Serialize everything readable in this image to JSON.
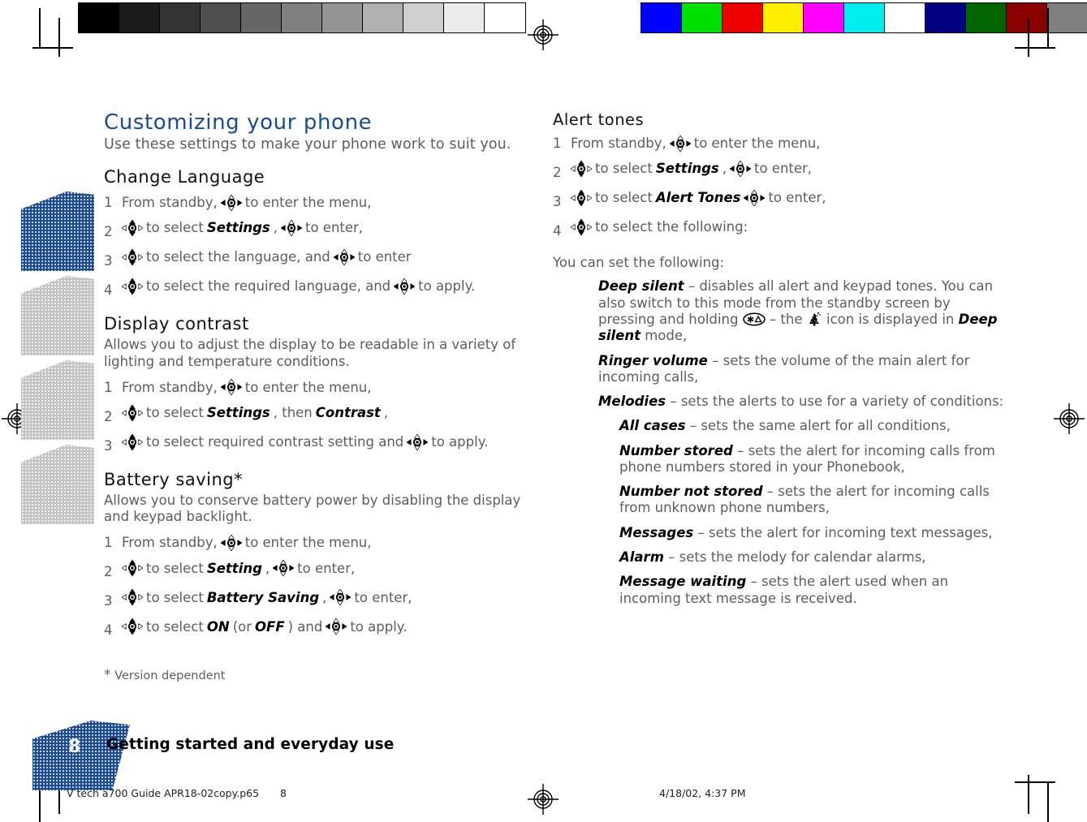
{
  "print_marks": {
    "gray_strip_label": "grayscale-calibration-strip",
    "gray_swatches": [
      "#000000",
      "#1c1c1c",
      "#333333",
      "#4d4d4d",
      "#666666",
      "#808080",
      "#939393",
      "#b0b0b0",
      "#cfcfcf",
      "#ececec",
      "#ffffff"
    ],
    "color_strip_label": "color-calibration-strip",
    "color_swatches": [
      "#0000ff",
      "#00e000",
      "#ee0000",
      "#ffee00",
      "#ff00ff",
      "#00eeee",
      "#ffffff",
      "#000080",
      "#006400",
      "#8b0000",
      "#808080"
    ]
  },
  "colors": {
    "heading_blue": "#1b4b93",
    "body_gray": "#5d5d5d",
    "tab_gray": "#c3c3c3"
  },
  "left_column": {
    "title": "Customizing your phone",
    "lead": "Use these settings to make your phone work to suit you.",
    "sections": [
      {
        "heading": "Change Language",
        "intro": "",
        "steps": [
          {
            "num": "1",
            "parts": [
              {
                "t": "text",
                "v": "From standby,"
              },
              {
                "t": "navkey",
                "v": "horizontal"
              },
              {
                "t": "text",
                "v": "to enter the menu,"
              }
            ]
          },
          {
            "num": "2",
            "parts": [
              {
                "t": "navkey",
                "v": "vertical"
              },
              {
                "t": "text",
                "v": "to select"
              },
              {
                "t": "em",
                "v": "Settings"
              },
              {
                "t": "text",
                "v": ","
              },
              {
                "t": "navkey",
                "v": "horizontal"
              },
              {
                "t": "text",
                "v": "to enter,"
              }
            ]
          },
          {
            "num": "3",
            "parts": [
              {
                "t": "navkey",
                "v": "vertical"
              },
              {
                "t": "text",
                "v": "to select the language, and"
              },
              {
                "t": "navkey",
                "v": "horizontal"
              },
              {
                "t": "text",
                "v": "to enter"
              }
            ]
          },
          {
            "num": "4",
            "parts": [
              {
                "t": "navkey",
                "v": "vertical"
              },
              {
                "t": "text",
                "v": "to select the required language, and"
              },
              {
                "t": "navkey",
                "v": "horizontal"
              },
              {
                "t": "text",
                "v": "to apply."
              }
            ]
          }
        ]
      },
      {
        "heading": "Display contrast",
        "intro": "Allows you to adjust the display to be readable in a variety of lighting and temperature conditions.",
        "steps": [
          {
            "num": "1",
            "parts": [
              {
                "t": "text",
                "v": "From standby,"
              },
              {
                "t": "navkey",
                "v": "horizontal"
              },
              {
                "t": "text",
                "v": "to enter the menu,"
              }
            ]
          },
          {
            "num": "2",
            "parts": [
              {
                "t": "navkey",
                "v": "vertical"
              },
              {
                "t": "text",
                "v": "to select"
              },
              {
                "t": "em",
                "v": "Settings"
              },
              {
                "t": "text",
                "v": ", then"
              },
              {
                "t": "em",
                "v": "Contrast"
              },
              {
                "t": "text",
                "v": ","
              }
            ]
          },
          {
            "num": "3",
            "parts": [
              {
                "t": "navkey",
                "v": "vertical"
              },
              {
                "t": "text",
                "v": "to select required contrast setting and"
              },
              {
                "t": "navkey",
                "v": "horizontal"
              },
              {
                "t": "text",
                "v": "to apply."
              }
            ]
          }
        ]
      },
      {
        "heading": "Battery saving*",
        "intro": "Allows you to conserve battery power by disabling the display and keypad backlight.",
        "steps": [
          {
            "num": "1",
            "parts": [
              {
                "t": "text",
                "v": "From standby,"
              },
              {
                "t": "navkey",
                "v": "horizontal"
              },
              {
                "t": "text",
                "v": "to enter the menu,"
              }
            ]
          },
          {
            "num": "2",
            "parts": [
              {
                "t": "navkey",
                "v": "vertical"
              },
              {
                "t": "text",
                "v": "to select"
              },
              {
                "t": "em",
                "v": "Setting"
              },
              {
                "t": "text",
                "v": ","
              },
              {
                "t": "navkey",
                "v": "horizontal"
              },
              {
                "t": "text",
                "v": "to enter,"
              }
            ]
          },
          {
            "num": "3",
            "parts": [
              {
                "t": "navkey",
                "v": "vertical"
              },
              {
                "t": "text",
                "v": "to select"
              },
              {
                "t": "em",
                "v": "Battery Saving"
              },
              {
                "t": "text",
                "v": ","
              },
              {
                "t": "navkey",
                "v": "horizontal"
              },
              {
                "t": "text",
                "v": "to enter,"
              }
            ]
          },
          {
            "num": "4",
            "parts": [
              {
                "t": "navkey",
                "v": "vertical"
              },
              {
                "t": "text",
                "v": "to select"
              },
              {
                "t": "em",
                "v": "ON"
              },
              {
                "t": "text",
                "v": "(or"
              },
              {
                "t": "em",
                "v": "OFF"
              },
              {
                "t": "text",
                "v": ") and"
              },
              {
                "t": "navkey",
                "v": "horizontal"
              },
              {
                "t": "text",
                "v": "to apply."
              }
            ]
          }
        ]
      }
    ],
    "footnote_marker": "*",
    "footnote_text": "Version dependent"
  },
  "right_column": {
    "heading": "Alert tones",
    "steps": [
      {
        "num": "1",
        "parts": [
          {
            "t": "text",
            "v": "From standby,"
          },
          {
            "t": "navkey",
            "v": "horizontal"
          },
          {
            "t": "text",
            "v": "to enter the menu,"
          }
        ]
      },
      {
        "num": "2",
        "parts": [
          {
            "t": "navkey",
            "v": "vertical"
          },
          {
            "t": "text",
            "v": "to select"
          },
          {
            "t": "em",
            "v": "Settings"
          },
          {
            "t": "text",
            "v": ","
          },
          {
            "t": "navkey",
            "v": "horizontal"
          },
          {
            "t": "text",
            "v": "to enter,"
          }
        ]
      },
      {
        "num": "3",
        "parts": [
          {
            "t": "navkey",
            "v": "vertical"
          },
          {
            "t": "text",
            "v": "to select"
          },
          {
            "t": "em",
            "v": "Alert Tones"
          },
          {
            "t": "navkey",
            "v": "horizontal"
          },
          {
            "t": "text",
            "v": "to enter,"
          }
        ]
      },
      {
        "num": "4",
        "parts": [
          {
            "t": "navkey",
            "v": "vertical"
          },
          {
            "t": "text",
            "v": "to select the following:"
          }
        ]
      }
    ],
    "note": "You can set the following:",
    "items": [
      {
        "level": 1,
        "term": "Deep silent",
        "segments": [
          {
            "t": "text",
            "v": "– disables all alert and keypad tones. You can also switch to this mode from the standby screen by pressing and holding"
          },
          {
            "t": "starkey",
            "v": "star-key"
          },
          {
            "t": "text",
            "v": "– the"
          },
          {
            "t": "dsicon",
            "v": "deep-silent-icon"
          },
          {
            "t": "text",
            "v": "icon is displayed in"
          },
          {
            "t": "em",
            "v": "Deep silent"
          },
          {
            "t": "text",
            "v": "mode,"
          }
        ]
      },
      {
        "level": 1,
        "term": "Ringer volume",
        "segments": [
          {
            "t": "text",
            "v": "– sets the volume of the main alert for incoming calls,"
          }
        ]
      },
      {
        "level": 1,
        "term": "Melodies",
        "segments": [
          {
            "t": "text",
            "v": "– sets the alerts to use for a variety of conditions:"
          }
        ]
      },
      {
        "level": 2,
        "term": "All cases",
        "segments": [
          {
            "t": "text",
            "v": "– sets the same alert for all conditions,"
          }
        ]
      },
      {
        "level": 2,
        "term": "Number stored",
        "segments": [
          {
            "t": "text",
            "v": "– sets the alert for incoming calls from phone numbers stored in your Phonebook,"
          }
        ]
      },
      {
        "level": 2,
        "term": "Number not stored",
        "segments": [
          {
            "t": "text",
            "v": "– sets the alert for incoming calls from unknown phone numbers,"
          }
        ]
      },
      {
        "level": 2,
        "term": "Messages",
        "segments": [
          {
            "t": "text",
            "v": "– sets the alert for incoming text messages,"
          }
        ]
      },
      {
        "level": 2,
        "term": "Alarm",
        "segments": [
          {
            "t": "text",
            "v": "– sets the melody for calendar alarms,"
          }
        ]
      },
      {
        "level": 2,
        "term": "Message waiting",
        "segments": [
          {
            "t": "text",
            "v": "– sets the alert used when an incoming text message is received."
          }
        ]
      }
    ]
  },
  "footer": {
    "page_number": "8",
    "title": "Getting started and everyday use",
    "print_file": "V tech a700 Guide APR18-02copy.p65",
    "print_page": "8",
    "print_date": "4/18/02, 4:37 PM"
  }
}
